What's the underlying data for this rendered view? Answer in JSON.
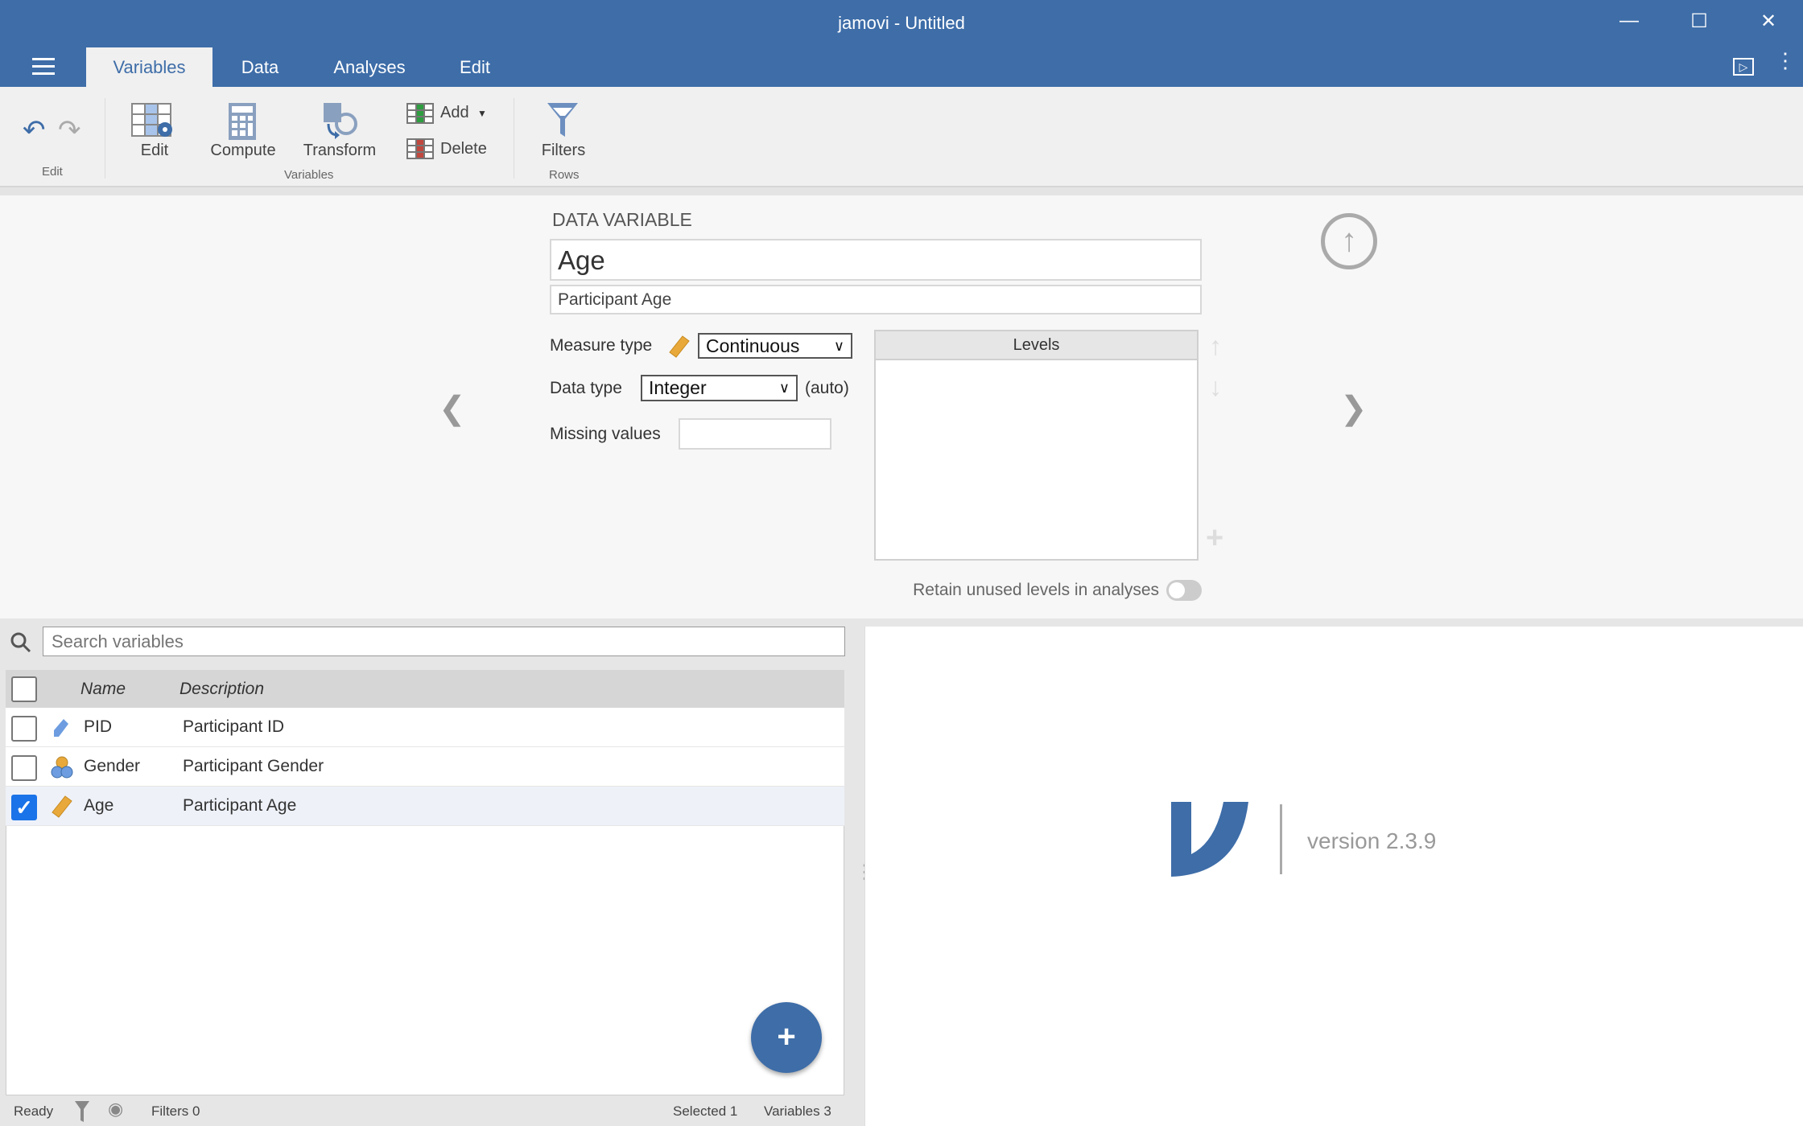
{
  "window": {
    "title": "jamovi - Untitled"
  },
  "tabs": [
    {
      "label": "Variables",
      "active": true
    },
    {
      "label": "Data"
    },
    {
      "label": "Analyses"
    },
    {
      "label": "Edit"
    }
  ],
  "ribbon": {
    "edit_group": "Edit",
    "variables_group": "Variables",
    "rows_group": "Rows",
    "edit": "Edit",
    "compute": "Compute",
    "transform": "Transform",
    "add": "Add",
    "delete": "Delete",
    "filters": "Filters"
  },
  "editor": {
    "section_title": "DATA VARIABLE",
    "name": "Age",
    "description": "Participant Age",
    "measure_type_label": "Measure type",
    "measure_type": "Continuous",
    "data_type_label": "Data type",
    "data_type": "Integer",
    "data_type_auto": "(auto)",
    "missing_values_label": "Missing values",
    "missing_values": "",
    "levels_header": "Levels",
    "retain_label": "Retain unused levels in analyses",
    "retain_on": false
  },
  "search": {
    "placeholder": "Search variables"
  },
  "table": {
    "columns": [
      "Name",
      "Description"
    ],
    "rows": [
      {
        "name": "PID",
        "description": "Participant ID",
        "type": "id",
        "checked": false
      },
      {
        "name": "Gender",
        "description": "Participant Gender",
        "type": "nominal",
        "checked": false
      },
      {
        "name": "Age",
        "description": "Participant Age",
        "type": "continuous",
        "checked": true
      }
    ]
  },
  "status": {
    "ready": "Ready",
    "filters": "Filters 0",
    "selected": "Selected 1",
    "variables": "Variables 3"
  },
  "results": {
    "version": "version 2.3.9"
  },
  "colors": {
    "brand": "#3e6da8",
    "continuous": "#e8a93a",
    "id": "#6d9de0",
    "check": "#1a73e8"
  }
}
